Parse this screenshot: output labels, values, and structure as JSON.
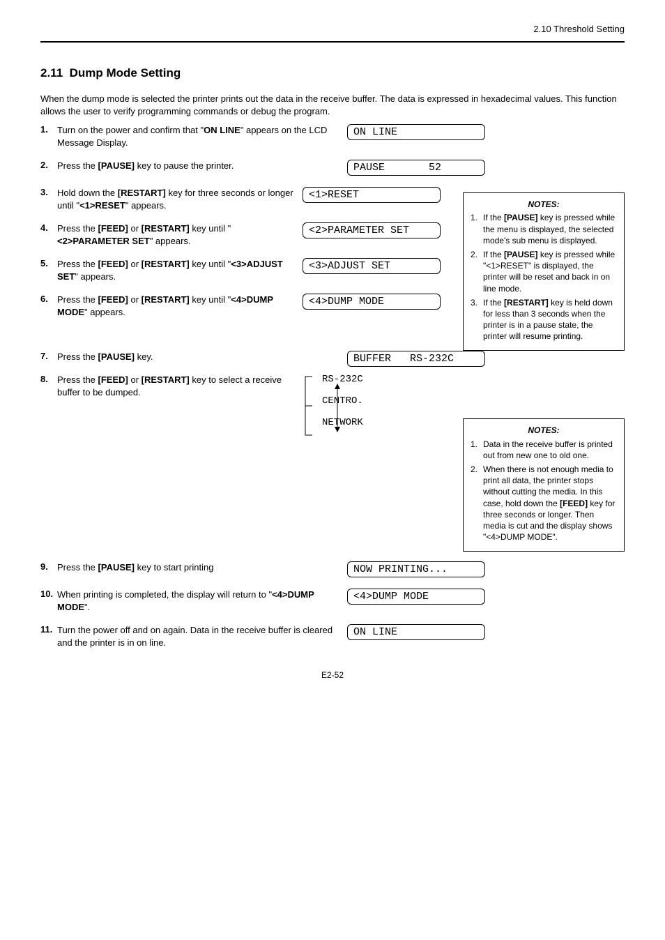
{
  "header_right": "2.10 Threshold Setting",
  "section_number": "2.11",
  "section_title": "Dump Mode Setting",
  "intro": "When the dump mode is selected the printer prints out the data in the receive buffer. The data is expressed in hexadecimal values. This function allows the user to verify programming commands or debug the program.",
  "steps": {
    "s1": {
      "text_pre": "Turn on the power and confirm that \"",
      "text_code": "ON LINE",
      "text_post": "\" appears on the LCD Message Display."
    },
    "s2": {
      "text": "Press the ",
      "key": "[PAUSE]",
      "text2": " key to pause the printer."
    },
    "s3": {
      "text": "Hold down the ",
      "key": "[RESTART]",
      "text2": " key for three seconds or longer until \"",
      "code": "<1>RESET",
      "text3": "\" appears."
    },
    "s4": {
      "text": "Press the ",
      "key1": "[FEED]",
      "text2": " or ",
      "key2": "[RESTART]",
      "text3": " key until \"",
      "code": "<2>PARAMETER SET",
      "text4": "\" appears."
    },
    "s5": {
      "text": "Press the ",
      "key1": "[FEED]",
      "text2": " or ",
      "key2": "[RESTART]",
      "text3": " key until \"",
      "code": "<3>ADJUST SET",
      "text4": "\" appears."
    },
    "s6": {
      "text": "Press the ",
      "key1": "[FEED]",
      "text2": " or ",
      "key2": "[RESTART]",
      "text3": " key until \"",
      "code": "<4>DUMP MODE",
      "text4": "\" appears."
    },
    "s7": {
      "text": "Press the ",
      "key": "[PAUSE]",
      "text2": " key."
    },
    "s8": {
      "text": "Press the ",
      "key1": "[FEED]",
      "text2": " or ",
      "key2": "[RESTART]",
      "text3": " key to select a receive buffer to be dumped."
    },
    "s9": {
      "text": "Press the ",
      "key": "[PAUSE]",
      "text2": " key to start printing"
    },
    "s10": {
      "text": "When printing is completed, the display will return to \"",
      "code": "<4>DUMP MODE",
      "text2": "\"."
    },
    "s11": {
      "text": "Turn the power off and on again. Data in the receive buffer is cleared and the printer is in on line."
    }
  },
  "lcd": {
    "l1": "ON LINE",
    "l2": "PAUSE       52",
    "l3": "<1>RESET",
    "l4": "<2>PARAMETER SET",
    "l5": "<3>ADJUST SET",
    "l6": "<4>DUMP MODE",
    "l7": "BUFFER   RS-232C",
    "select": [
      "RS-232C",
      "CENTRO.",
      "NETWORK"
    ],
    "l8": "NOW PRINTING...",
    "l9": "<4>DUMP MODE",
    "l10": "ON LINE"
  },
  "notes": {
    "n1": {
      "title": "NOTES:",
      "items": [
        {
          "n": "1.",
          "t": "If the ",
          "k": "[PAUSE]",
          "t2": " key is pressed while the menu is displayed, the selected mode's sub menu is displayed."
        },
        {
          "n": "2.",
          "t": "If the ",
          "k": "[PAUSE]",
          "t2": " key is pressed while \"",
          "c": "<1>RESET",
          "t3": "\" is displayed, the printer will be reset and back in on line mode."
        },
        {
          "n": "3.",
          "t": "If the ",
          "k": "[RESTART]",
          "t2": " key is held down for less than 3 seconds when the printer is in a pause state, the printer will resume printing."
        }
      ]
    },
    "n2": {
      "title": "NOTES:",
      "items": [
        {
          "n": "1.",
          "t": "Data in the receive buffer is printed out from new one to old one."
        },
        {
          "n": "2.",
          "t": "When there is not enough media to print all data, the printer stops without cutting the media. In this case, hold down the ",
          "k": "[FEED]",
          "t2": " key for three seconds or longer. Then media is cut and the display shows \"",
          "c": "<4>DUMP MODE",
          "t3": "\"."
        }
      ]
    }
  },
  "page_number": "E2-52"
}
